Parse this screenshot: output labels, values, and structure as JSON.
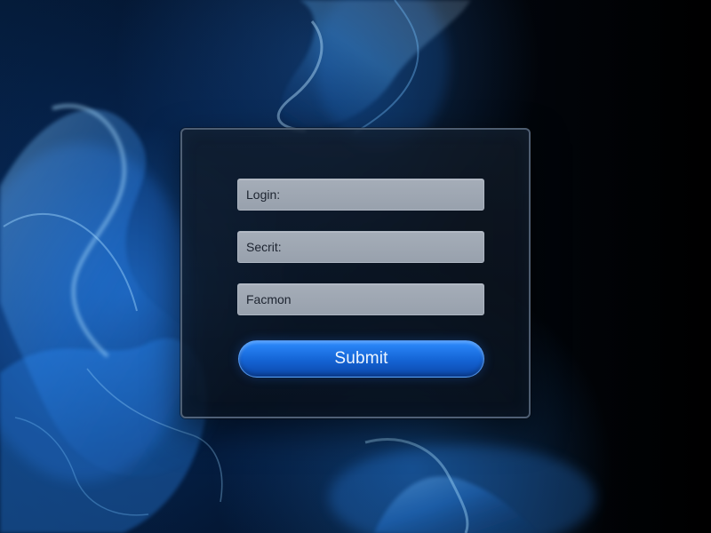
{
  "login_form": {
    "fields": {
      "login": "Login:",
      "secret": "Secrit:",
      "third": "Facmon"
    },
    "submit_label": "Submit"
  },
  "colors": {
    "panel_background": "#101925",
    "field_background": "#a0a8b3",
    "accent_blue": "#1f78f0",
    "background_dark": "#02060d"
  }
}
